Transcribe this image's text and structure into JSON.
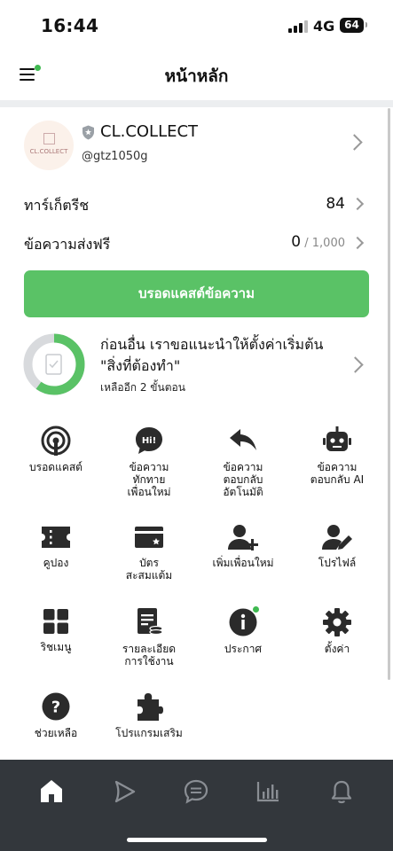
{
  "status_bar": {
    "time": "16:44",
    "network": "4G",
    "battery": "64"
  },
  "header": {
    "title": "หน้าหลัก"
  },
  "account": {
    "logo_text": "CL.COLLECT",
    "name": "CL.COLLECT",
    "id": "@gtz1050g"
  },
  "stats": [
    {
      "label": "ทาร์เก็ตรีช",
      "value": "84",
      "suffix": ""
    },
    {
      "label": "ข้อความส่งฟรี",
      "value": "0",
      "suffix": " / 1,000"
    }
  ],
  "broadcast_button": "บรอดแคสต์ข้อความ",
  "todo": {
    "title": "ก่อนอื่น เราขอแนะนำให้ตั้งค่าเริ่มต้น \"สิ่งที่ต้องทำ\"",
    "subtitle": "เหลืออีก 2 ขั้นตอน",
    "progress": 0.6
  },
  "features": [
    {
      "label": "บรอดแคสต์",
      "icon": "broadcast-icon"
    },
    {
      "label": "ข้อความ\nทักทาย\nเพื่อนใหม่",
      "icon": "hi-greeting-icon"
    },
    {
      "label": "ข้อความ\nตอบกลับ\nอัตโนมัติ",
      "icon": "reply-icon"
    },
    {
      "label": "ข้อความ\nตอบกลับ AI",
      "icon": "bot-icon"
    },
    {
      "label": "คูปอง",
      "icon": "coupon-icon"
    },
    {
      "label": "บัตร\nสะสมแต้ม",
      "icon": "reward-card-icon"
    },
    {
      "label": "เพิ่มเพื่อนใหม่",
      "icon": "add-friend-icon"
    },
    {
      "label": "โปรไฟล์",
      "icon": "profile-edit-icon"
    },
    {
      "label": "ริชเมนู",
      "icon": "rich-menu-icon"
    },
    {
      "label": "รายละเอียด\nการใช้งาน",
      "icon": "usage-icon"
    },
    {
      "label": "ประกาศ",
      "icon": "info-icon"
    },
    {
      "label": "ตั้งค่า",
      "icon": "gear-icon"
    },
    {
      "label": "ช่วยเหลือ",
      "icon": "help-icon"
    },
    {
      "label": "โปรแกรมเสริม",
      "icon": "puzzle-icon"
    }
  ],
  "bottom_nav": [
    {
      "icon": "home-icon",
      "active": true
    },
    {
      "icon": "voom-icon",
      "active": false
    },
    {
      "icon": "chat-icon",
      "active": false
    },
    {
      "icon": "insight-icon",
      "active": false
    },
    {
      "icon": "bell-icon",
      "active": false
    }
  ],
  "colors": {
    "accent": "#5ac266",
    "dark_nav": "#33373c"
  }
}
